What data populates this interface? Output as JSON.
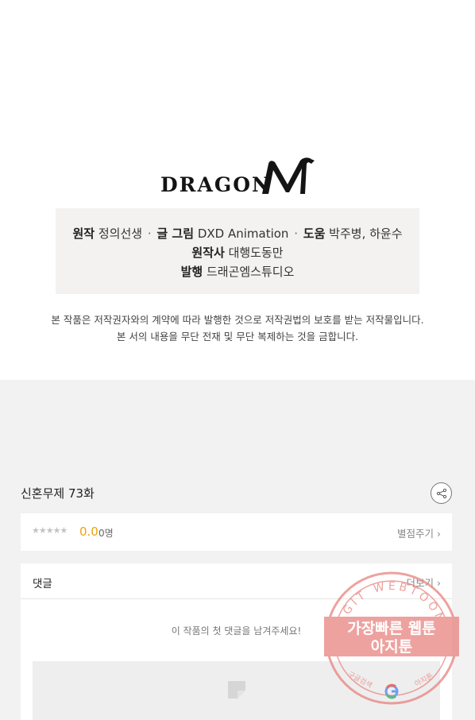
{
  "logo": {
    "text": "DRAGON",
    "mark": "M"
  },
  "credits": {
    "original_label": "원작",
    "original_value": "정의선생",
    "art_label": "글 그림",
    "art_value": "DXD Animation",
    "assist_label": "도움",
    "assist_value": "박주병, 하윤수",
    "publisher_label": "원작사",
    "publisher_value": "대행도동만",
    "issuer_label": "발행",
    "issuer_value": "드래곤엠스튜디오"
  },
  "copyright": {
    "line1": "본 작품은 저작권자와의 계약에 따라 발행한 것으로 저작권법의 보호를 받는 저작물입니다.",
    "line2": "본 서의 내용을 무단 전재 및 무단 복제하는 것을 금합니다."
  },
  "episode": {
    "title": "신혼무제 73화"
  },
  "rating": {
    "stars": "★★★★★",
    "score": "0.0",
    "count": "0명",
    "rate_label": "별점주기 ›"
  },
  "comments": {
    "title": "댓글",
    "more_label": "더보기 ›",
    "empty_message": "이 작품의 첫 댓글을 남겨주세요!"
  },
  "stamp": {
    "ring_text": "AGIT WEBTOON",
    "line1": "가장빠른 웹툰",
    "line2": "아지툰",
    "bottom_left": "구글검색",
    "bottom_right": "아지툰"
  },
  "colors": {
    "score": "#f0a30a",
    "stamp": "#e8837f",
    "bottom_bg": "#f2f2f2",
    "credits_bg": "#f4f1f1"
  }
}
